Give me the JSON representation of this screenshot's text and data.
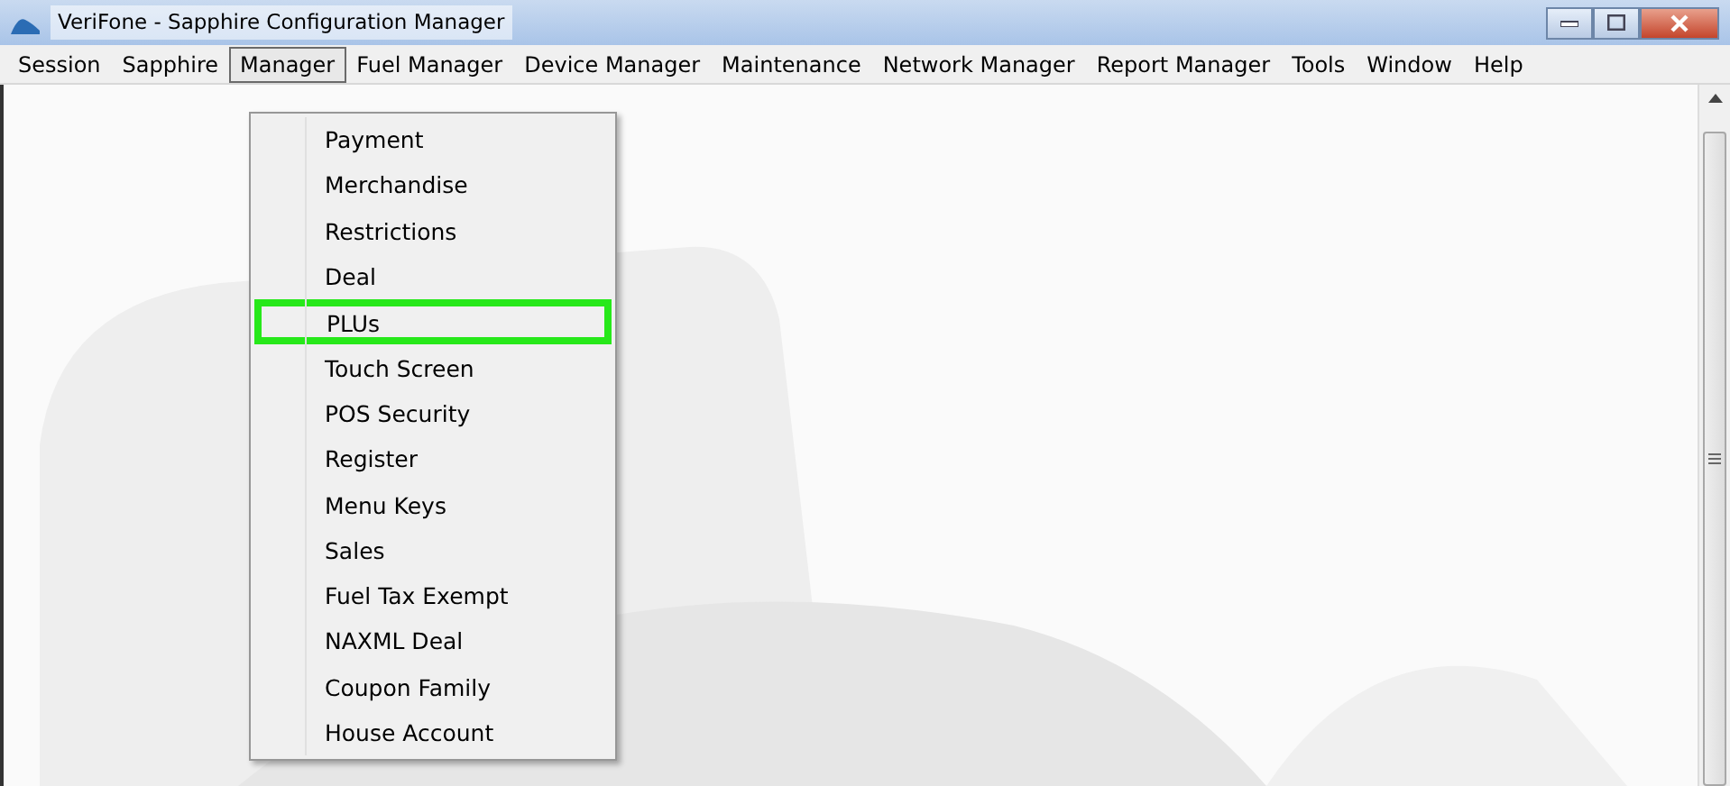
{
  "window": {
    "title": "VeriFone - Sapphire Configuration Manager"
  },
  "menubar": [
    {
      "label": "Session",
      "selected": false
    },
    {
      "label": "Sapphire",
      "selected": false
    },
    {
      "label": "Manager",
      "selected": true
    },
    {
      "label": "Fuel Manager",
      "selected": false
    },
    {
      "label": "Device Manager",
      "selected": false
    },
    {
      "label": "Maintenance",
      "selected": false
    },
    {
      "label": "Network Manager",
      "selected": false
    },
    {
      "label": "Report Manager",
      "selected": false
    },
    {
      "label": "Tools",
      "selected": false
    },
    {
      "label": "Window",
      "selected": false
    },
    {
      "label": "Help",
      "selected": false
    }
  ],
  "dropdown": [
    {
      "label": "Payment",
      "highlighted": false
    },
    {
      "label": "Merchandise",
      "highlighted": false
    },
    {
      "label": "Restrictions",
      "highlighted": false
    },
    {
      "label": "Deal",
      "highlighted": false
    },
    {
      "label": "PLUs",
      "highlighted": true
    },
    {
      "label": "Touch Screen",
      "highlighted": false
    },
    {
      "label": "POS Security",
      "highlighted": false
    },
    {
      "label": "Register",
      "highlighted": false
    },
    {
      "label": "Menu Keys",
      "highlighted": false
    },
    {
      "label": "Sales",
      "highlighted": false
    },
    {
      "label": "Fuel Tax Exempt",
      "highlighted": false
    },
    {
      "label": "NAXML Deal",
      "highlighted": false
    },
    {
      "label": "Coupon Family",
      "highlighted": false
    },
    {
      "label": "House Account",
      "highlighted": false
    }
  ]
}
